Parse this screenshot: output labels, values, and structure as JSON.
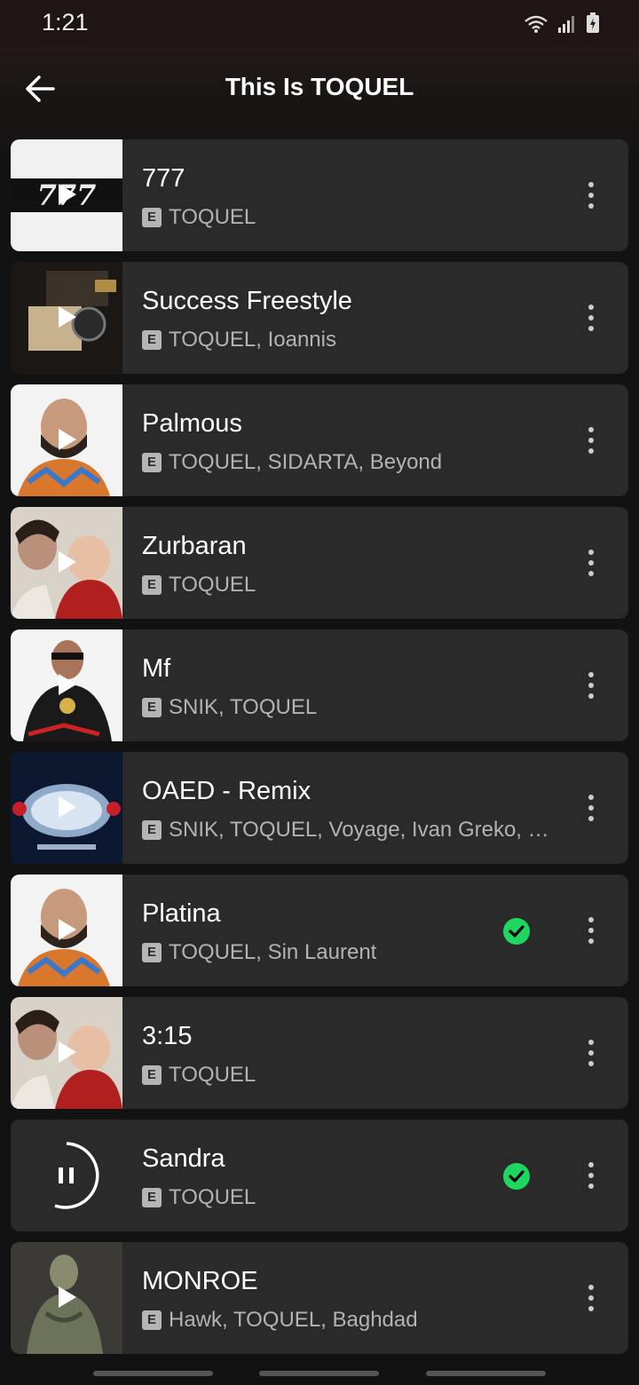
{
  "status": {
    "time": "1:21"
  },
  "header": {
    "title": "This Is TOQUEL"
  },
  "explicit_badge": "E",
  "tracks": [
    {
      "title": "777",
      "artists": "TOQUEL",
      "downloaded": false
    },
    {
      "title": "Success Freestyle",
      "artists": "TOQUEL, Ioannis",
      "downloaded": false
    },
    {
      "title": "Palmous",
      "artists": "TOQUEL, SIDARTA, Beyond",
      "downloaded": false
    },
    {
      "title": "Zurbaran",
      "artists": "TOQUEL",
      "downloaded": false
    },
    {
      "title": "Mf",
      "artists": "SNIK, TOQUEL",
      "downloaded": false
    },
    {
      "title": "OAED - Remix",
      "artists": "SNIK, TOQUEL, Voyage, Ivan Greko, …",
      "downloaded": false
    },
    {
      "title": "Platina",
      "artists": "TOQUEL, Sin Laurent",
      "downloaded": true
    },
    {
      "title": "3:15",
      "artists": "TOQUEL",
      "downloaded": false
    },
    {
      "title": "Sandra",
      "artists": "TOQUEL",
      "downloaded": true,
      "now_playing": true
    },
    {
      "title": "MONROE",
      "artists": "Hawk, TOQUEL, Baghdad",
      "downloaded": false
    }
  ],
  "art_777_text": "777",
  "colors": {
    "accent": "#1ed760",
    "row_bg": "#2a2a2a",
    "background": "#121212"
  },
  "icons": [
    "back-arrow-icon",
    "play-icon",
    "pause-icon",
    "more-vertical-icon",
    "downloaded-check-icon",
    "wifi-icon",
    "signal-icon",
    "battery-icon"
  ]
}
